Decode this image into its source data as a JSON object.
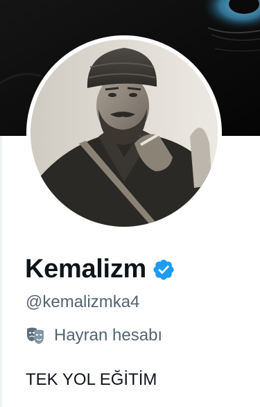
{
  "profile": {
    "display_name": "Kemalizm",
    "handle": "@kemalizmka4",
    "category_label": "Hayran hesabı",
    "bio": "TEK YOL EĞİTİM",
    "verified": true
  },
  "icons": {
    "verified": "verified-badge-icon",
    "category": "theater-masks-icon"
  },
  "colors": {
    "verified_blue": "#1d9bf0",
    "name_text": "#0f1419",
    "secondary_text": "#536471",
    "banner_bg": "#0c0c0c"
  }
}
